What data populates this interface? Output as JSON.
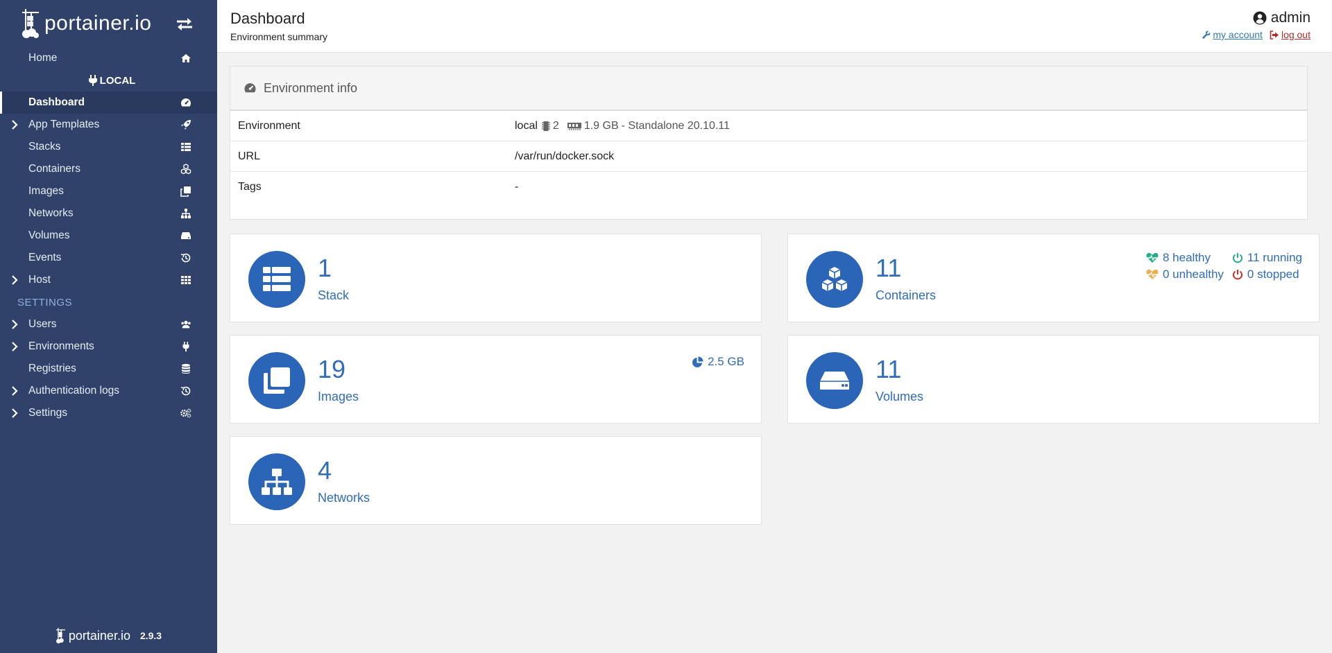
{
  "brand": {
    "name": "portainer.io",
    "toggle_icon": "exchange-icon"
  },
  "sidebar": {
    "home": "Home",
    "environment_name": "LOCAL",
    "items": [
      {
        "label": "Dashboard",
        "icon": "tachometer-icon",
        "active": true,
        "expandable": false
      },
      {
        "label": "App Templates",
        "icon": "rocket-icon",
        "expandable": true
      },
      {
        "label": "Stacks",
        "icon": "list-icon",
        "expandable": false
      },
      {
        "label": "Containers",
        "icon": "cubes-icon",
        "expandable": false
      },
      {
        "label": "Images",
        "icon": "clone-icon",
        "expandable": false
      },
      {
        "label": "Networks",
        "icon": "sitemap-icon",
        "expandable": false
      },
      {
        "label": "Volumes",
        "icon": "hdd-icon",
        "expandable": false
      },
      {
        "label": "Events",
        "icon": "history-icon",
        "expandable": false
      },
      {
        "label": "Host",
        "icon": "th-icon",
        "expandable": true
      }
    ],
    "settings_heading": "SETTINGS",
    "settings_items": [
      {
        "label": "Users",
        "icon": "users-icon",
        "expandable": true
      },
      {
        "label": "Environments",
        "icon": "plug-icon",
        "expandable": true
      },
      {
        "label": "Registries",
        "icon": "database-icon",
        "expandable": false
      },
      {
        "label": "Authentication logs",
        "icon": "history-icon",
        "expandable": true
      },
      {
        "label": "Settings",
        "icon": "cogs-icon",
        "expandable": true
      }
    ],
    "footer": {
      "brand": "portainer.io",
      "version": "2.9.3"
    }
  },
  "header": {
    "title": "Dashboard",
    "subtitle": "Environment summary",
    "username": "admin",
    "my_account": "my account",
    "log_out": "log out"
  },
  "env_info": {
    "title": "Environment info",
    "rows": [
      {
        "key": "Environment",
        "value": "local",
        "cpu": "2",
        "memory": "1.9 GB",
        "mode": "- Standalone 20.10.11"
      },
      {
        "key": "URL",
        "value": "/var/run/docker.sock"
      },
      {
        "key": "Tags",
        "value": "-"
      }
    ]
  },
  "stats": {
    "stacks": {
      "value": "1",
      "label": "Stack"
    },
    "containers": {
      "value": "11",
      "label": "Containers",
      "healthy": "8 healthy",
      "unhealthy": "0 unhealthy",
      "running": "11 running",
      "stopped": "0 stopped"
    },
    "images": {
      "value": "19",
      "label": "Images",
      "size": "2.5 GB"
    },
    "volumes": {
      "value": "11",
      "label": "Volumes"
    },
    "networks": {
      "value": "4",
      "label": "Networks"
    }
  },
  "colors": {
    "sidebar_bg": "#30426a",
    "accent_blue": "#2b65b7",
    "healthy_green": "#23ae89",
    "unhealthy_orange": "#f0ad4e",
    "stopped_red": "#c9302c",
    "logout_red": "#b02b2b"
  }
}
